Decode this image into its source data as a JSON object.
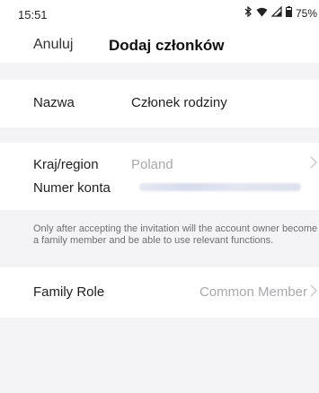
{
  "status_bar": {
    "time": "15:51",
    "battery": "75%",
    "icons": [
      "bluetooth-icon",
      "wifi-icon",
      "signal-icon",
      "battery-icon"
    ]
  },
  "nav": {
    "cancel_label": "Anuluj",
    "title": "Dodaj członków"
  },
  "form": {
    "name": {
      "label": "Nazwa",
      "value": "Członek rodziny"
    },
    "region": {
      "label": "Kraj/region",
      "value": "Poland"
    },
    "account": {
      "label": "Numer konta",
      "value_masked": true
    },
    "note": "Only after accepting the invitation will the account owner become a family member and be able to use relevant functions.",
    "role": {
      "label": "Family Role",
      "value": "Common Member"
    }
  },
  "colors": {
    "background": "#f4f4f6",
    "card": "#ffffff",
    "muted_text": "#a9a9ad",
    "note_text": "#6f6f73"
  }
}
